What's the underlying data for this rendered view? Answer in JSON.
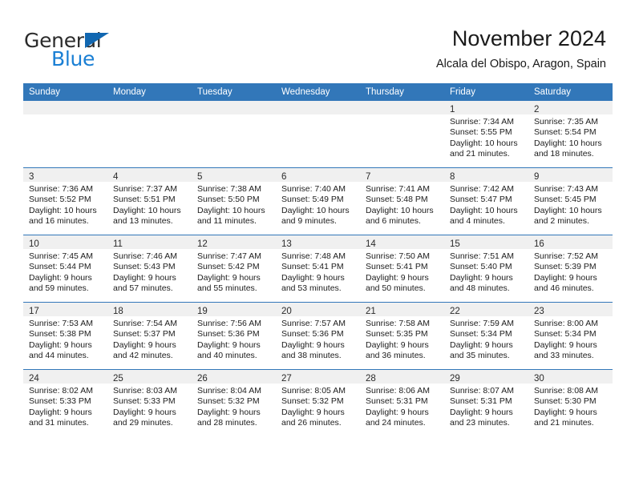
{
  "brand": {
    "name_part1": "General",
    "name_part2": "Blue",
    "logo_icon": "triangle-icon",
    "accent_color": "#1a7fd4",
    "triangle_color": "#1167b1"
  },
  "header": {
    "title": "November 2024",
    "subtitle": "Alcala del Obispo, Aragon, Spain"
  },
  "calendar": {
    "header_bg": "#3277b9",
    "date_band_bg": "#f0f0f0",
    "weekdays": [
      "Sunday",
      "Monday",
      "Tuesday",
      "Wednesday",
      "Thursday",
      "Friday",
      "Saturday"
    ],
    "weeks": [
      [
        {
          "empty": true
        },
        {
          "empty": true
        },
        {
          "empty": true
        },
        {
          "empty": true
        },
        {
          "empty": true
        },
        {
          "day": "1",
          "sunrise": "Sunrise: 7:34 AM",
          "sunset": "Sunset: 5:55 PM",
          "daylight_line1": "Daylight: 10 hours",
          "daylight_line2": "and 21 minutes."
        },
        {
          "day": "2",
          "sunrise": "Sunrise: 7:35 AM",
          "sunset": "Sunset: 5:54 PM",
          "daylight_line1": "Daylight: 10 hours",
          "daylight_line2": "and 18 minutes."
        }
      ],
      [
        {
          "day": "3",
          "sunrise": "Sunrise: 7:36 AM",
          "sunset": "Sunset: 5:52 PM",
          "daylight_line1": "Daylight: 10 hours",
          "daylight_line2": "and 16 minutes."
        },
        {
          "day": "4",
          "sunrise": "Sunrise: 7:37 AM",
          "sunset": "Sunset: 5:51 PM",
          "daylight_line1": "Daylight: 10 hours",
          "daylight_line2": "and 13 minutes."
        },
        {
          "day": "5",
          "sunrise": "Sunrise: 7:38 AM",
          "sunset": "Sunset: 5:50 PM",
          "daylight_line1": "Daylight: 10 hours",
          "daylight_line2": "and 11 minutes."
        },
        {
          "day": "6",
          "sunrise": "Sunrise: 7:40 AM",
          "sunset": "Sunset: 5:49 PM",
          "daylight_line1": "Daylight: 10 hours",
          "daylight_line2": "and 9 minutes."
        },
        {
          "day": "7",
          "sunrise": "Sunrise: 7:41 AM",
          "sunset": "Sunset: 5:48 PM",
          "daylight_line1": "Daylight: 10 hours",
          "daylight_line2": "and 6 minutes."
        },
        {
          "day": "8",
          "sunrise": "Sunrise: 7:42 AM",
          "sunset": "Sunset: 5:47 PM",
          "daylight_line1": "Daylight: 10 hours",
          "daylight_line2": "and 4 minutes."
        },
        {
          "day": "9",
          "sunrise": "Sunrise: 7:43 AM",
          "sunset": "Sunset: 5:45 PM",
          "daylight_line1": "Daylight: 10 hours",
          "daylight_line2": "and 2 minutes."
        }
      ],
      [
        {
          "day": "10",
          "sunrise": "Sunrise: 7:45 AM",
          "sunset": "Sunset: 5:44 PM",
          "daylight_line1": "Daylight: 9 hours",
          "daylight_line2": "and 59 minutes."
        },
        {
          "day": "11",
          "sunrise": "Sunrise: 7:46 AM",
          "sunset": "Sunset: 5:43 PM",
          "daylight_line1": "Daylight: 9 hours",
          "daylight_line2": "and 57 minutes."
        },
        {
          "day": "12",
          "sunrise": "Sunrise: 7:47 AM",
          "sunset": "Sunset: 5:42 PM",
          "daylight_line1": "Daylight: 9 hours",
          "daylight_line2": "and 55 minutes."
        },
        {
          "day": "13",
          "sunrise": "Sunrise: 7:48 AM",
          "sunset": "Sunset: 5:41 PM",
          "daylight_line1": "Daylight: 9 hours",
          "daylight_line2": "and 53 minutes."
        },
        {
          "day": "14",
          "sunrise": "Sunrise: 7:50 AM",
          "sunset": "Sunset: 5:41 PM",
          "daylight_line1": "Daylight: 9 hours",
          "daylight_line2": "and 50 minutes."
        },
        {
          "day": "15",
          "sunrise": "Sunrise: 7:51 AM",
          "sunset": "Sunset: 5:40 PM",
          "daylight_line1": "Daylight: 9 hours",
          "daylight_line2": "and 48 minutes."
        },
        {
          "day": "16",
          "sunrise": "Sunrise: 7:52 AM",
          "sunset": "Sunset: 5:39 PM",
          "daylight_line1": "Daylight: 9 hours",
          "daylight_line2": "and 46 minutes."
        }
      ],
      [
        {
          "day": "17",
          "sunrise": "Sunrise: 7:53 AM",
          "sunset": "Sunset: 5:38 PM",
          "daylight_line1": "Daylight: 9 hours",
          "daylight_line2": "and 44 minutes."
        },
        {
          "day": "18",
          "sunrise": "Sunrise: 7:54 AM",
          "sunset": "Sunset: 5:37 PM",
          "daylight_line1": "Daylight: 9 hours",
          "daylight_line2": "and 42 minutes."
        },
        {
          "day": "19",
          "sunrise": "Sunrise: 7:56 AM",
          "sunset": "Sunset: 5:36 PM",
          "daylight_line1": "Daylight: 9 hours",
          "daylight_line2": "and 40 minutes."
        },
        {
          "day": "20",
          "sunrise": "Sunrise: 7:57 AM",
          "sunset": "Sunset: 5:36 PM",
          "daylight_line1": "Daylight: 9 hours",
          "daylight_line2": "and 38 minutes."
        },
        {
          "day": "21",
          "sunrise": "Sunrise: 7:58 AM",
          "sunset": "Sunset: 5:35 PM",
          "daylight_line1": "Daylight: 9 hours",
          "daylight_line2": "and 36 minutes."
        },
        {
          "day": "22",
          "sunrise": "Sunrise: 7:59 AM",
          "sunset": "Sunset: 5:34 PM",
          "daylight_line1": "Daylight: 9 hours",
          "daylight_line2": "and 35 minutes."
        },
        {
          "day": "23",
          "sunrise": "Sunrise: 8:00 AM",
          "sunset": "Sunset: 5:34 PM",
          "daylight_line1": "Daylight: 9 hours",
          "daylight_line2": "and 33 minutes."
        }
      ],
      [
        {
          "day": "24",
          "sunrise": "Sunrise: 8:02 AM",
          "sunset": "Sunset: 5:33 PM",
          "daylight_line1": "Daylight: 9 hours",
          "daylight_line2": "and 31 minutes."
        },
        {
          "day": "25",
          "sunrise": "Sunrise: 8:03 AM",
          "sunset": "Sunset: 5:33 PM",
          "daylight_line1": "Daylight: 9 hours",
          "daylight_line2": "and 29 minutes."
        },
        {
          "day": "26",
          "sunrise": "Sunrise: 8:04 AM",
          "sunset": "Sunset: 5:32 PM",
          "daylight_line1": "Daylight: 9 hours",
          "daylight_line2": "and 28 minutes."
        },
        {
          "day": "27",
          "sunrise": "Sunrise: 8:05 AM",
          "sunset": "Sunset: 5:32 PM",
          "daylight_line1": "Daylight: 9 hours",
          "daylight_line2": "and 26 minutes."
        },
        {
          "day": "28",
          "sunrise": "Sunrise: 8:06 AM",
          "sunset": "Sunset: 5:31 PM",
          "daylight_line1": "Daylight: 9 hours",
          "daylight_line2": "and 24 minutes."
        },
        {
          "day": "29",
          "sunrise": "Sunrise: 8:07 AM",
          "sunset": "Sunset: 5:31 PM",
          "daylight_line1": "Daylight: 9 hours",
          "daylight_line2": "and 23 minutes."
        },
        {
          "day": "30",
          "sunrise": "Sunrise: 8:08 AM",
          "sunset": "Sunset: 5:30 PM",
          "daylight_line1": "Daylight: 9 hours",
          "daylight_line2": "and 21 minutes."
        }
      ]
    ]
  }
}
